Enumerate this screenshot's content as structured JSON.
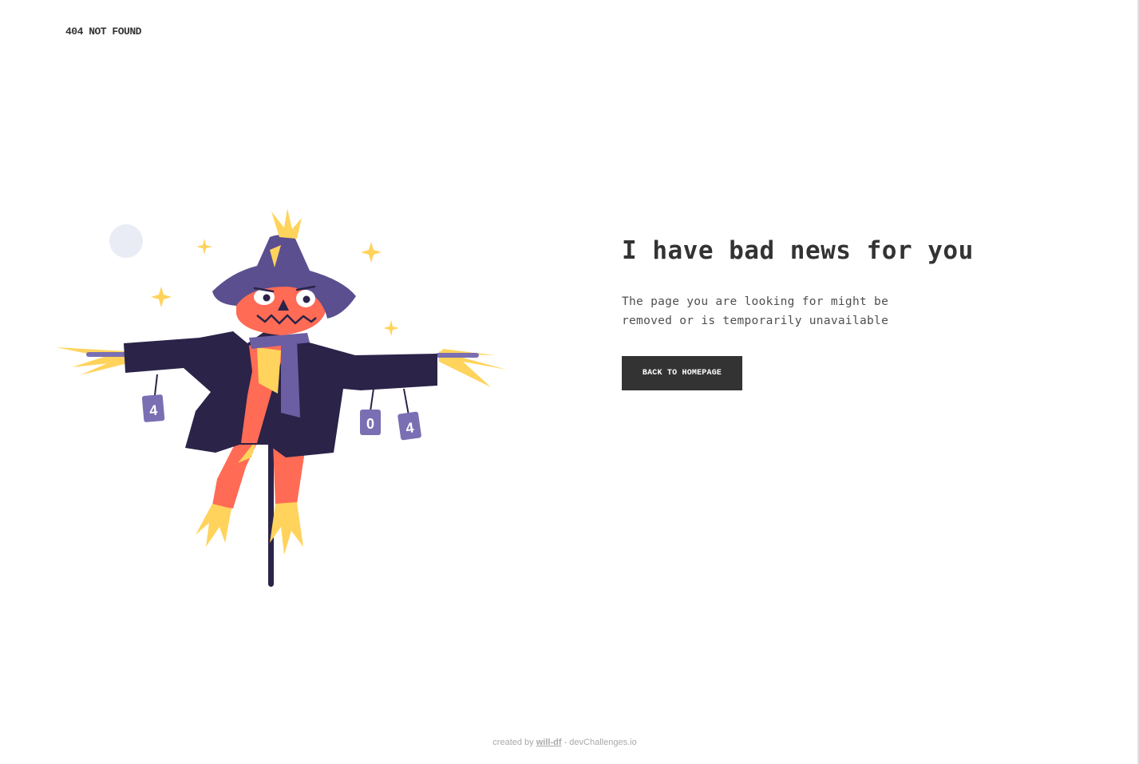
{
  "header": {
    "brand": "404 NOT FOUND"
  },
  "main": {
    "headline": "I have bad news for you",
    "description": "The page you are looking for might be removed or is temporarily unavailable",
    "button_label": "BACK TO HOMEPAGE"
  },
  "illustration": {
    "subject": "scarecrow",
    "can_labels": [
      "4",
      "0",
      "4"
    ]
  },
  "footer": {
    "prefix": "created by",
    "author_link": "will-df",
    "suffix": "- devChallenges.io"
  },
  "colors": {
    "text": "#333333",
    "button_bg": "#333333",
    "button_text": "#ffffff",
    "coat": "#2b2348",
    "hat": "#5b4f8f",
    "face": "#ff6b55",
    "straw": "#ffd35c",
    "scarf": "#6b5ea3",
    "moon": "#e9ebf5"
  }
}
